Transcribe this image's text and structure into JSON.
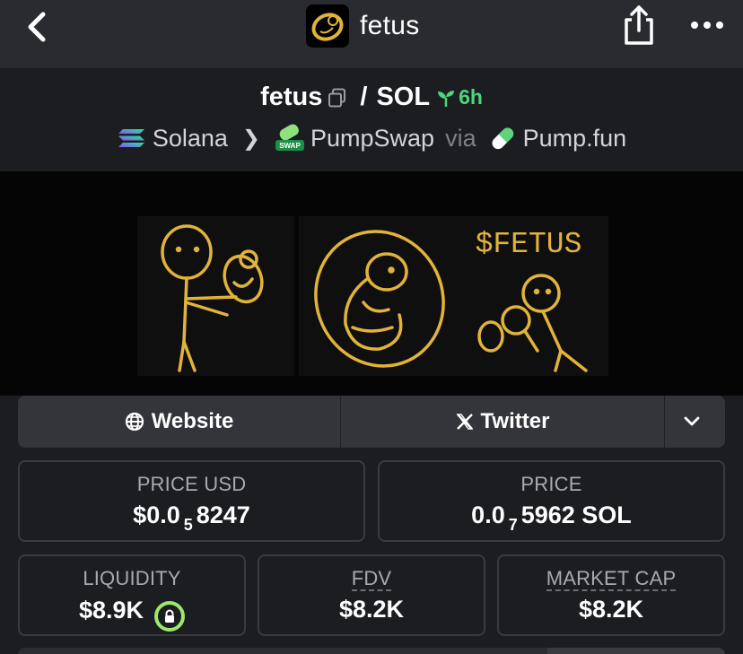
{
  "nav": {
    "title": "fetus",
    "back_icon": "chevron-left-icon",
    "share_icon": "share-icon",
    "more_icon": "more-dots-icon"
  },
  "pair": {
    "base": "fetus",
    "slash": "/",
    "quote": "SOL",
    "age": "6h",
    "chain": "Solana",
    "dex": "PumpSwap",
    "via_label": "via",
    "launchpad": "Pump.fun",
    "swap_badge": "SWAP"
  },
  "banner": {
    "ticker_text": "$FETUS"
  },
  "links": {
    "website": "Website",
    "twitter": "Twitter"
  },
  "stats": {
    "price_usd": {
      "label": "PRICE USD",
      "prefix": "$0.0",
      "zeros": "5",
      "digits": "8247"
    },
    "price_sol": {
      "label": "PRICE",
      "prefix": "0.0",
      "zeros": "7",
      "digits": "5962 SOL"
    },
    "liquidity": {
      "label": "LIQUIDITY",
      "value": "$8.9K"
    },
    "fdv": {
      "label": "FDV",
      "value": "$8.2K"
    },
    "market_cap": {
      "label": "MARKET CAP",
      "value": "$8.2K"
    }
  },
  "colors": {
    "accent_green": "#4cd67a",
    "lock_green": "#9be86b",
    "gold": "#e2b33a"
  }
}
